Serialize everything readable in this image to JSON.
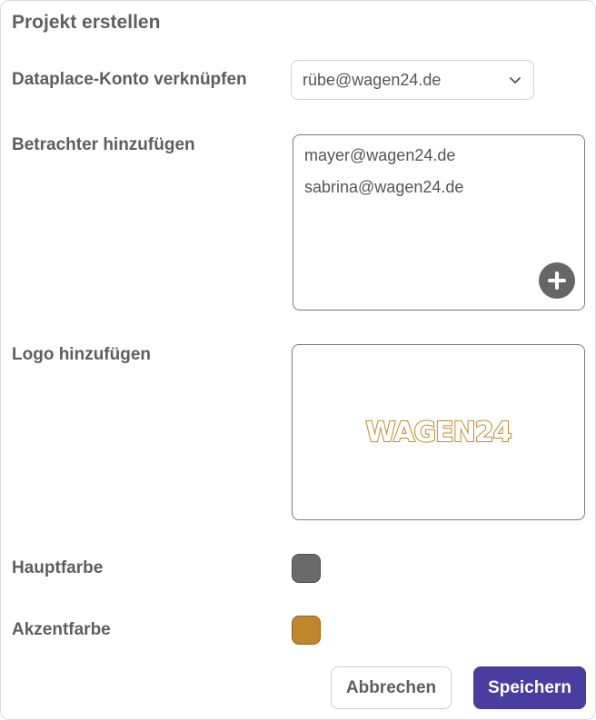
{
  "dialog": {
    "title": "Projekt erstellen"
  },
  "account": {
    "label": "Dataplace-Konto verknüpfen",
    "selected": "rübe@wagen24.de"
  },
  "viewers": {
    "label": "Betrachter hinzufügen",
    "items": [
      "mayer@wagen24.de",
      "sabrina@wagen24.de"
    ],
    "add_icon": "plus-circle-icon"
  },
  "logo": {
    "label": "Logo hinzufügen",
    "text": "WAGEN24",
    "color": "#c08a2c"
  },
  "colors": {
    "primary_label": "Hauptfarbe",
    "primary_value": "#6a6a6a",
    "accent_label": "Akzentfarbe",
    "accent_value": "#c0862e"
  },
  "actions": {
    "cancel_label": "Abbrechen",
    "save_label": "Speichern",
    "save_color": "#4a3da0"
  }
}
